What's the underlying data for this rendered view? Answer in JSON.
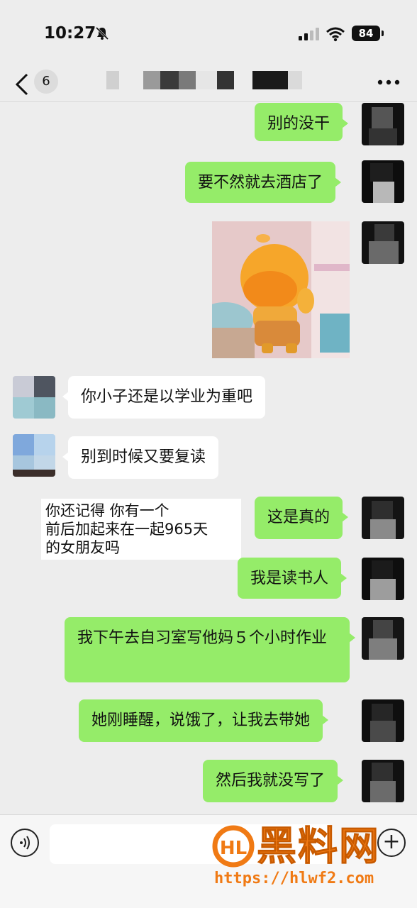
{
  "status_bar": {
    "time": "10:27",
    "battery": "84"
  },
  "nav": {
    "unread_count": "6"
  },
  "messages": [
    {
      "side": "me",
      "text": "别的没干"
    },
    {
      "side": "me",
      "text": "要不然就去酒店了"
    },
    {
      "side": "me",
      "type": "sticker",
      "icon": "cartoon-sticker"
    },
    {
      "side": "other",
      "text": "你小子还是以学业为重吧"
    },
    {
      "side": "other",
      "text": "别到时候又要复读"
    },
    {
      "side": "me",
      "text": "这是真的"
    },
    {
      "side": "me",
      "text": "我是读书人"
    },
    {
      "side": "me",
      "text": "我下午去自习室写他妈５个小时作业"
    },
    {
      "side": "me",
      "text": "她刚睡醒，说饿了，让我去带她"
    },
    {
      "side": "me",
      "text": "然后我就没写了"
    }
  ],
  "overlay_caption": "你还记得 你有一个\n前后加起来在一起965天\n的女朋友吗",
  "watermark": {
    "name": "黑料网",
    "url": "https://hlwf2.com"
  },
  "colors": {
    "my_bubble": "#95ec69",
    "their_bubble": "#ffffff",
    "background": "#ededed",
    "watermark": "#f07a14"
  }
}
